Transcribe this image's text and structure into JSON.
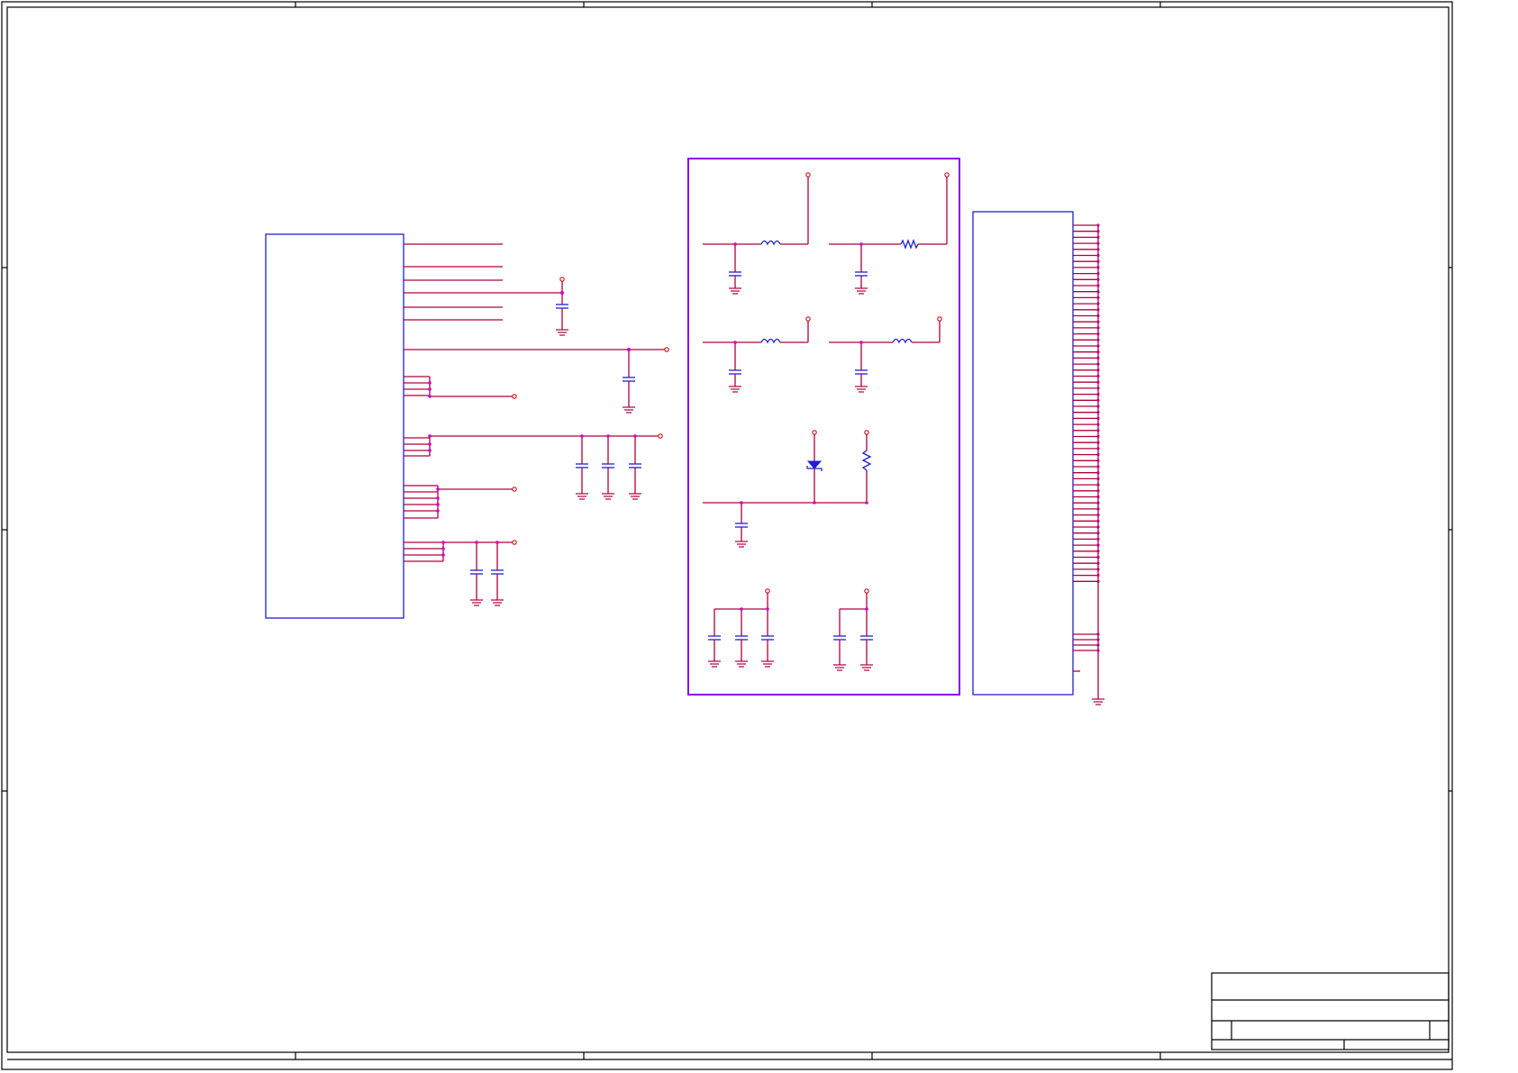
{
  "sheet": {
    "zone_columns": 5,
    "zone_rows": 4,
    "title_block": {
      "title": "",
      "size": "",
      "document_number": "",
      "revision": "",
      "date": "",
      "sheet_of": ""
    }
  },
  "colors": {
    "wire": "#b0003a",
    "component": "#1f1fd0",
    "junction": "#d000c8",
    "port": "#d01010",
    "group_box": "#8a00e6",
    "frame": "#000000"
  },
  "blocks": {
    "left_ic": {
      "pin_stubs": 22
    },
    "power_filter_group": {
      "ferrite_filters": 4,
      "diode": 1,
      "resistor": 1
    },
    "connector": {
      "pins": 72
    }
  },
  "symbols": [
    "capacitor",
    "inductor",
    "resistor",
    "zener-diode",
    "ground",
    "power-port",
    "junction"
  ]
}
